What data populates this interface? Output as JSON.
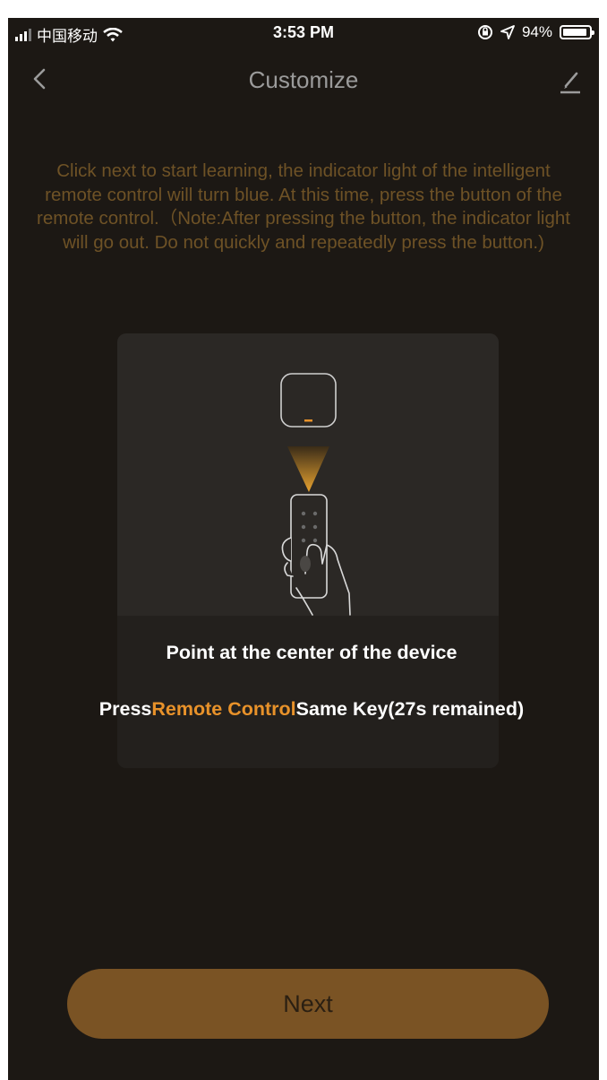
{
  "status_bar": {
    "carrier": "中国移动",
    "time": "3:53 PM",
    "battery": "94%",
    "icons": [
      "signal-icon",
      "wifi-icon",
      "orientation-lock-icon",
      "location-icon",
      "battery-icon"
    ]
  },
  "nav": {
    "title": "Customize",
    "back_icon": "chevron-left-icon",
    "edit_icon": "pencil-icon"
  },
  "instructions": "Click next to start learning, the indicator light of the intelligent remote control will turn blue. At this time, press the button of the remote control.（Note:After pressing the button, the indicator light will go out. Do not quickly and repeatedly press the button.)",
  "card": {
    "illustration_icons": [
      "hub-device-icon",
      "signal-beam-icon",
      "remote-in-hand-icon"
    ],
    "headline": "Point at the center of the device",
    "press_prefix": "Press",
    "press_highlight": "Remote Control",
    "press_suffix": "Same Key(27s remained)"
  },
  "next_button": "Next",
  "colors": {
    "background": "#1c1814",
    "accent": "#e8922a",
    "button": "#7a5324",
    "instruction_text": "#6e5226"
  }
}
